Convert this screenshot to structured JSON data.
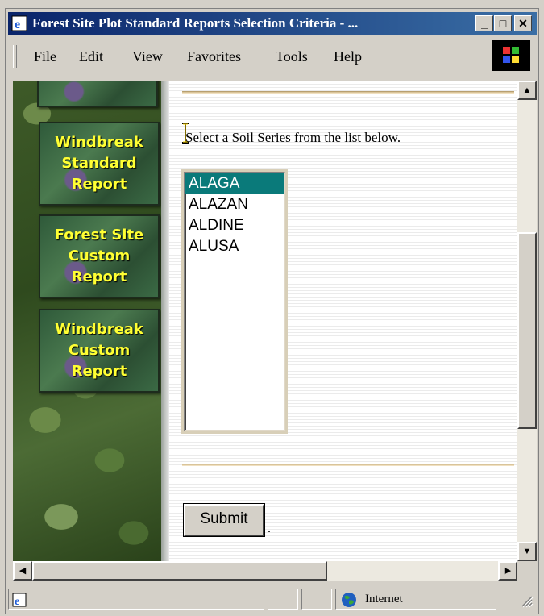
{
  "window": {
    "title": "Forest Site Plot Standard Reports Selection Criteria - ...",
    "controls": {
      "minimize": "_",
      "maximize": "□",
      "close": "✕"
    }
  },
  "menubar": {
    "file": "File",
    "edit": "Edit",
    "view": "View",
    "favorites": "Favorites",
    "tools": "Tools",
    "help": "Help"
  },
  "sidebar": {
    "buttons": [
      {
        "line1": "Windbreak",
        "line2": "Standard",
        "line3": "Report"
      },
      {
        "line1": "Forest Site",
        "line2": "Custom",
        "line3": "Report"
      },
      {
        "line1": "Windbreak",
        "line2": "Custom",
        "line3": "Report"
      }
    ]
  },
  "main": {
    "prompt": "Select a Soil Series from the list below.",
    "soil_series": [
      "ALAGA",
      "ALAZAN",
      "ALDINE",
      "ALUSA"
    ],
    "selected": "ALAGA",
    "submit_label": "Submit",
    "submit_trailer": "."
  },
  "statusbar": {
    "zone": "Internet"
  },
  "colors": {
    "titlebar": "#0a246a",
    "selection": "#0a7a7a",
    "nav_text": "#ffff33"
  }
}
